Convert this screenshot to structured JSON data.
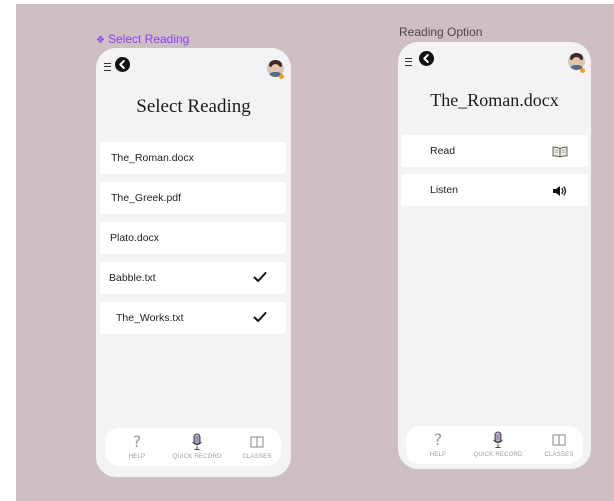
{
  "frame_labels": {
    "select_reading": "Select Reading",
    "reading_option": "Reading Option"
  },
  "select_reading_screen": {
    "title": "Select Reading",
    "files": [
      {
        "name": "The_Roman.docx",
        "checked": false
      },
      {
        "name": "The_Greek.pdf",
        "checked": false
      },
      {
        "name": "Plato.docx",
        "checked": false
      },
      {
        "name": "Babble.txt",
        "checked": true
      },
      {
        "name": "The_Works.txt",
        "checked": true
      }
    ]
  },
  "reading_option_screen": {
    "title": "The_Roman.docx",
    "options": [
      {
        "label": "Read",
        "icon": "book-icon"
      },
      {
        "label": "Listen",
        "icon": "speaker-icon"
      }
    ]
  },
  "bottom_nav": {
    "help": "HELP",
    "quick_record": "QUICK RECORD",
    "classes": "CLASSES"
  },
  "colors": {
    "canvas": "#cdbfc2",
    "component_label": "#8a3ffc",
    "screen_bg": "#f3f2f5"
  }
}
